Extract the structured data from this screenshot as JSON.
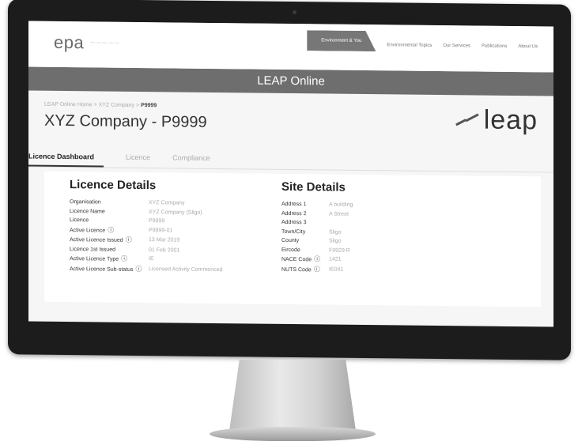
{
  "header": {
    "logo": "epa",
    "nav_active": "Environment & You",
    "nav_items": [
      "Environmental Topics",
      "Our Services",
      "Publications",
      "About Us"
    ]
  },
  "banner_title": "LEAP Online",
  "breadcrumb": [
    "LEAP Online Home",
    "XYZ Company",
    "P9999"
  ],
  "page_title": "XYZ Company - P9999",
  "leap_logo": "leap",
  "tabs": [
    "Licence Dashboard",
    "Licence",
    "Compliance"
  ],
  "licence_details": {
    "heading": "Licence Details",
    "rows": [
      {
        "label": "Organisation",
        "value": "XYZ Company"
      },
      {
        "label": "Licence Name",
        "value": "XYZ Company (Sligo)"
      },
      {
        "label": "Licence",
        "value": "P9999"
      },
      {
        "label": "Active Licence",
        "value": "P9999-01"
      },
      {
        "label": "Active Licence Issued",
        "value": "13 Mar 2019"
      },
      {
        "label": "Licence 1st Issued",
        "value": "01 Feb 2001"
      },
      {
        "label": "Active Licence Type",
        "value": "IE"
      },
      {
        "label": "Active Licence Sub-status",
        "value": "Licensed Activity Commenced"
      }
    ]
  },
  "site_details": {
    "heading": "Site Details",
    "rows": [
      {
        "label": "Address 1",
        "value": "A building"
      },
      {
        "label": "Address 2",
        "value": "A Street"
      },
      {
        "label": "Address 3",
        "value": ""
      },
      {
        "label": "Town/City",
        "value": "Sligo"
      },
      {
        "label": "County",
        "value": "Sligo"
      },
      {
        "label": "Eircode",
        "value": "F9929 R"
      },
      {
        "label": "NACE Code",
        "value": "1421"
      },
      {
        "label": "NUTS Code",
        "value": "IE041"
      }
    ]
  }
}
